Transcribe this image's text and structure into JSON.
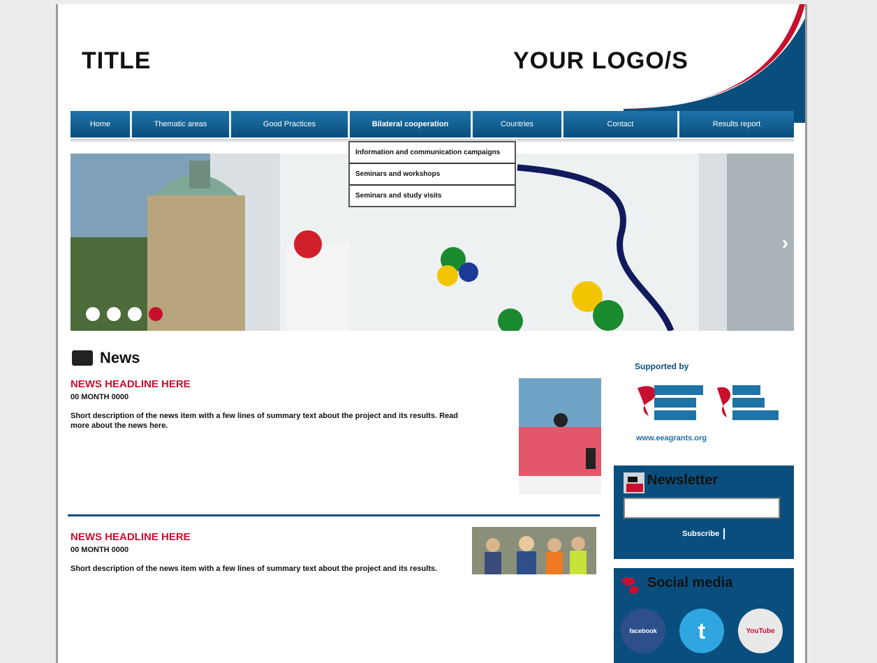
{
  "header": {
    "title": "TITLE",
    "logo_text": "YOUR LOGO/S"
  },
  "nav": {
    "items": [
      {
        "label": "Home"
      },
      {
        "label": "Thematic areas"
      },
      {
        "label": "Good Practices"
      },
      {
        "label": "Bilateral cooperation",
        "active": true
      },
      {
        "label": "Countries"
      },
      {
        "label": "Contact"
      },
      {
        "label": "Results report"
      }
    ],
    "dropdown": [
      {
        "label": "Information and communication campaigns"
      },
      {
        "label": "Seminars and workshops"
      },
      {
        "label": "Seminars and study visits"
      }
    ]
  },
  "slider": {
    "next_glyph": "›",
    "dot_count": 4,
    "active_dot": 3
  },
  "news": {
    "heading": "News",
    "articles": [
      {
        "title": "NEWS HEADLINE HERE",
        "date": "00 MONTH 0000",
        "body": "Short description of the news item with a few lines of summary text about the project and its results. Read more about the news here."
      },
      {
        "title": "NEWS HEADLINE HERE",
        "date": "00 MONTH 0000",
        "body": "Short description of the news item with a few lines of summary text about the project and its results."
      }
    ]
  },
  "sidebar": {
    "supported_by": "Supported by",
    "partner_link": "www.eeagrants.org",
    "newsletter": {
      "title": "Newsletter",
      "input_placeholder": "",
      "button": "Subscribe"
    },
    "social": {
      "title": "Social media",
      "facebook": "facebook",
      "twitter": "t",
      "youtube": "YouTube"
    }
  },
  "colors": {
    "brand_blue": "#0a4e7e",
    "accent_red": "#c8102e",
    "nav_blue": "#1e73a8"
  },
  "icons": [
    "news-icon",
    "newsletter-icon",
    "social-media-icon",
    "facebook-icon",
    "twitter-icon",
    "youtube-icon"
  ]
}
